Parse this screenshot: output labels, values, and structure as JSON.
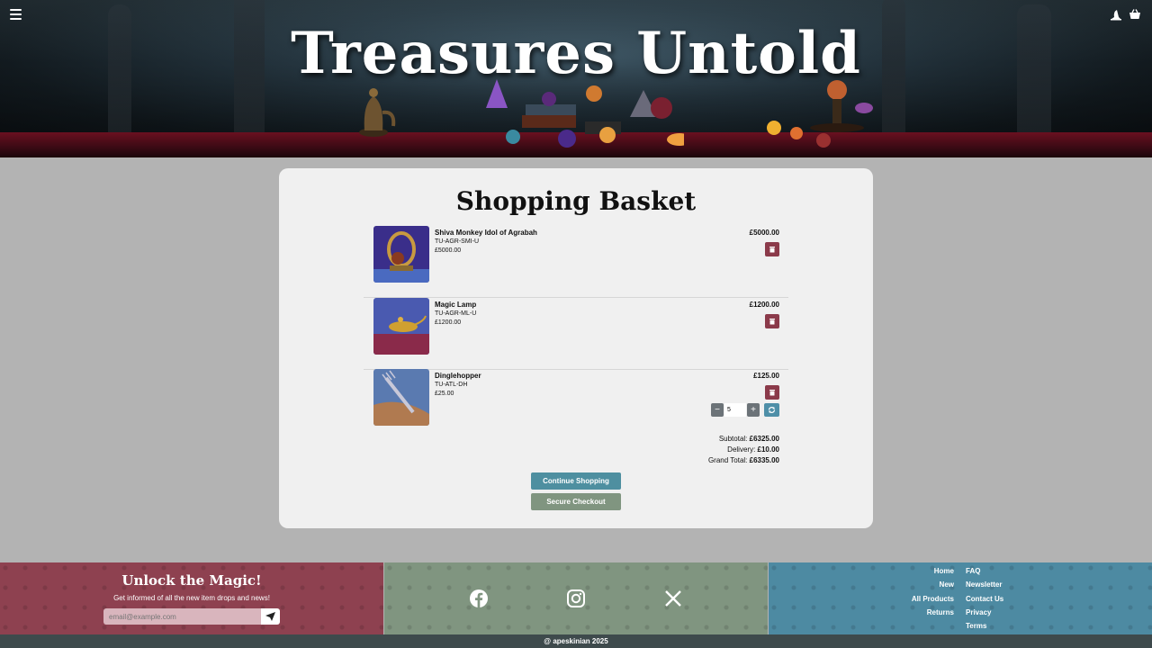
{
  "header": {
    "title": "Treasures Untold",
    "menu_icon": "hamburger-menu-icon",
    "account_icon": "wizard-hat-icon",
    "basket_icon": "basket-icon"
  },
  "basket": {
    "title": "Shopping Basket",
    "items": [
      {
        "name": "Shiva Monkey Idol of Agrabah",
        "sku": "TU-AGR-SMI-U",
        "unit_price": "£5000.00",
        "line_total": "£5000.00"
      },
      {
        "name": "Magic Lamp",
        "sku": "TU-AGR-ML-U",
        "unit_price": "£1200.00",
        "line_total": "£1200.00"
      },
      {
        "name": "Dinglehopper",
        "sku": "TU-ATL-DH",
        "unit_price": "£25.00",
        "line_total": "£125.00",
        "quantity": "5",
        "minus_label": "−",
        "plus_label": "+"
      }
    ],
    "subtotal_label": "Subtotal:",
    "subtotal": "£6325.00",
    "delivery_label": "Delivery:",
    "delivery": "£10.00",
    "grand_total_label": "Grand Total:",
    "grand_total": "£6335.00",
    "continue_label": "Continue Shopping",
    "checkout_label": "Secure Checkout"
  },
  "footer": {
    "newsletter_title": "Unlock the Magic!",
    "newsletter_text": "Get informed of all the new item drops and news!",
    "email_placeholder": "email@example.com",
    "social": [
      "facebook-icon",
      "instagram-icon",
      "x-icon"
    ],
    "links_left": [
      "Home",
      "New",
      "All Products",
      "Returns"
    ],
    "links_right": [
      "FAQ",
      "Newsletter",
      "Contact Us",
      "Privacy",
      "Terms"
    ],
    "copyright": "@ apeskinian 2025"
  },
  "colors": {
    "delete": "#8b3a4a",
    "continue": "#4e8fa0",
    "checkout": "#809580",
    "footer_left": "#8e4150",
    "footer_mid": "#809580",
    "footer_right": "#4d8aa2",
    "copyright_bar": "#3e4a4c"
  }
}
